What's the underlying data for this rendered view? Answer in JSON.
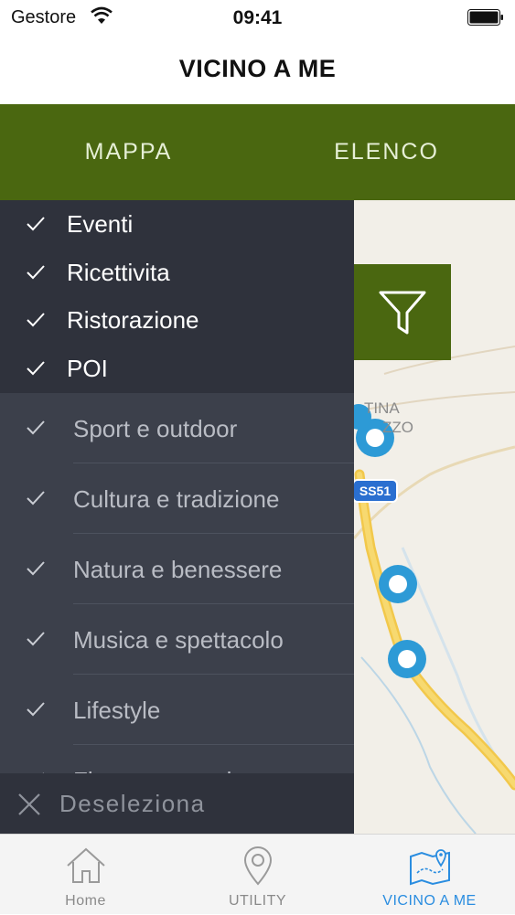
{
  "status_bar": {
    "carrier": "Gestore",
    "time": "09:41"
  },
  "nav": {
    "title": "VICINO A ME"
  },
  "segments": [
    {
      "label": "MAPPA"
    },
    {
      "label": "ELENCO"
    }
  ],
  "map": {
    "road_label": "SS51",
    "place_label_1": "TINA",
    "place_label_2": "ZZO"
  },
  "filter_button": {
    "icon": "filter-icon"
  },
  "categories": [
    {
      "label": "Eventi",
      "checked": true
    },
    {
      "label": "Ricettivita",
      "checked": true
    },
    {
      "label": "Ristorazione",
      "checked": true
    },
    {
      "label": "POI",
      "checked": true
    }
  ],
  "subcategories": [
    {
      "label": "Sport e outdoor",
      "checked": true
    },
    {
      "label": "Cultura e tradizione",
      "checked": true
    },
    {
      "label": "Natura e benessere",
      "checked": true
    },
    {
      "label": "Musica e spettacolo",
      "checked": true
    },
    {
      "label": "Lifestyle",
      "checked": true
    },
    {
      "label": "Fiere e mercati",
      "checked": true
    }
  ],
  "deselect": {
    "label": "Deseleziona"
  },
  "tabbar": [
    {
      "label": "Home",
      "icon": "home-icon"
    },
    {
      "label": "UTILITY",
      "icon": "location-pin-icon"
    },
    {
      "label": "VICINO A ME",
      "icon": "map-icon",
      "active": true
    }
  ],
  "colors": {
    "green": "#4a6710",
    "panel_dark": "#2f323c",
    "panel_sub": "#3c404b",
    "accent": "#2a8de0"
  }
}
